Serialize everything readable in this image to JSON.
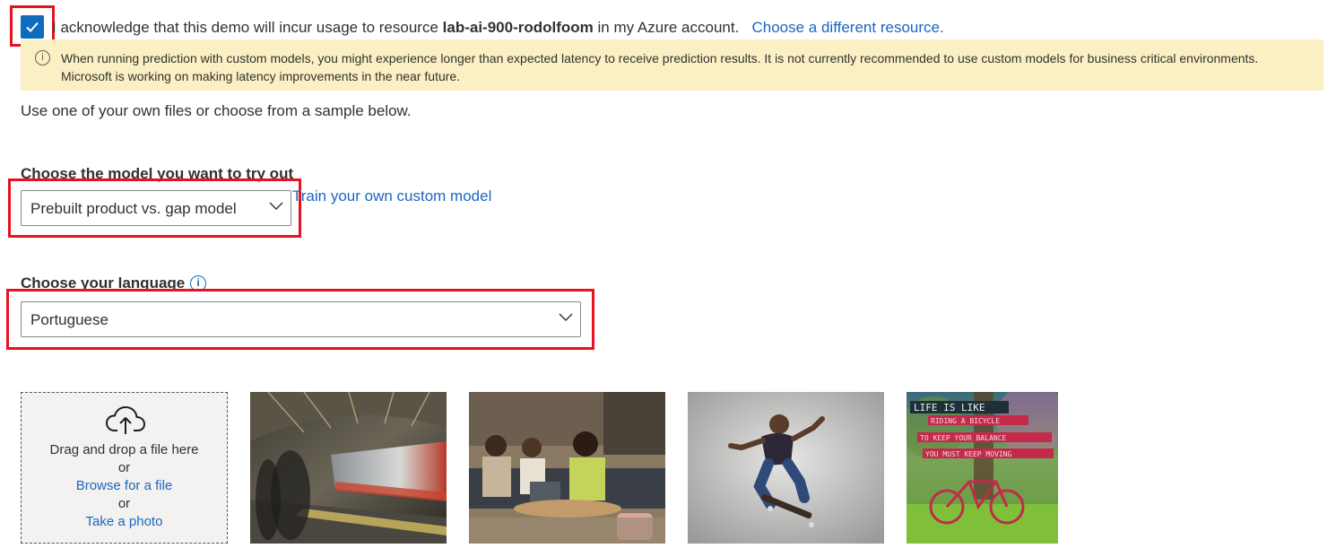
{
  "ack": {
    "checked": true,
    "text_prefix": "I acknowledge that this demo will incur usage to resource",
    "resource_name": "lab-ai-900-rodolfoom",
    "text_suffix": "in my Azure account.",
    "change_link": "Choose a different resource."
  },
  "banner": {
    "icon": "info-icon",
    "text": "When running prediction with custom models, you might experience longer than expected latency to receive prediction results.  It is not currently recommended to use custom models for business critical environments. Microsoft is working on making latency improvements in the near future."
  },
  "intro": "Use one of your own files or choose from a sample below.",
  "model": {
    "label": "Choose the model you want to try out",
    "selected": "Prebuilt product vs. gap model",
    "train_link": "Train your own custom model"
  },
  "language": {
    "label": "Choose your language",
    "selected": "Portuguese"
  },
  "upload": {
    "icon": "cloud-upload-icon",
    "drag_text": "Drag and drop a file here",
    "or1": "or",
    "browse": "Browse for a file",
    "or2": "or",
    "photo": "Take a photo"
  },
  "samples": [
    {
      "name": "sample-train-station"
    },
    {
      "name": "sample-office-meeting"
    },
    {
      "name": "sample-skateboarder"
    },
    {
      "name": "sample-life-is-like",
      "lines": [
        "LIFE IS LIKE",
        "RIDING A BICYCLE",
        "TO KEEP YOUR BALANCE",
        "YOU MUST KEEP MOVING"
      ]
    }
  ],
  "colors": {
    "accent": "#0f6cbd",
    "link": "#1a67c0",
    "highlight": "#e81123",
    "banner_bg": "#fbf0c3"
  }
}
